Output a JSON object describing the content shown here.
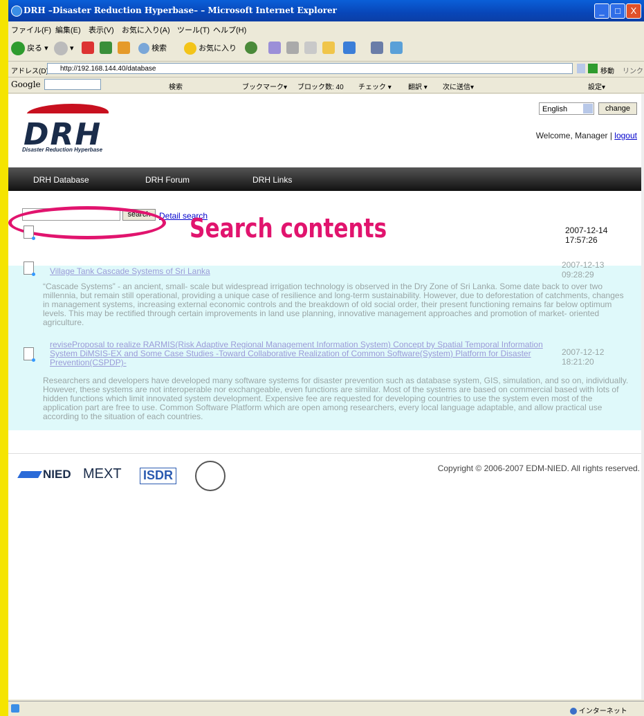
{
  "window": {
    "title": "DRH –Disaster Reduction Hyperbase– – Microsoft Internet Explorer",
    "controls": {
      "minimize": "_",
      "maximize": "□",
      "close": "X"
    }
  },
  "menu": [
    "ファイル(F)",
    "編集(E)",
    "表示(V)",
    "お気に入り(A)",
    "ツール(T)",
    "ヘルプ(H)"
  ],
  "toolbar": {
    "back_label": "戻る",
    "search_label": "検索",
    "favorites_label": "お気に入り"
  },
  "address": {
    "label": "アドレス(D)",
    "url": "http://192.168.144.40/database",
    "go_label": "移動",
    "links_label": "リンク"
  },
  "google_toolbar": {
    "brand": "Google",
    "search_label": "検索",
    "bookmarks_label": "ブックマーク▾",
    "blocked_label": "ブロック数: 40",
    "check_label": "チェック ▾",
    "translate_label": "翻訳 ▾",
    "send_label": "次に送信▾",
    "settings_label": "設定▾"
  },
  "site": {
    "logo_text": "DRH",
    "logo_subtitle": "Disaster Reduction Hyperbase",
    "language": "English",
    "change_label": "change",
    "welcome": "Welcome, Manager | ",
    "logout": "logout",
    "nav": [
      "DRH Database",
      "DRH Forum",
      "DRH Links"
    ]
  },
  "search": {
    "button_label": "search",
    "detail_link": "Detail search",
    "callout": "Search contents"
  },
  "entries": [
    {
      "date": "2007-12-14",
      "time": "17:57:26"
    },
    {
      "title": "Village Tank Cascade Systems of Sri Lanka",
      "date": "2007-12-13",
      "time": "09:28:29",
      "description": "“Cascade Systems” - an ancient, small- scale but widespread irrigation technology is observed in the Dry Zone of Sri Lanka. Some date back to over two millennia, but remain still operational, providing a unique case of resilience and long-term sustainability. However, due to deforestation of catchments, changes in management systems, increasing external economic controls and the breakdown of old social order, their present functioning remains far below optimum levels. This may be rectified through certain improvements in land use planning, innovative management approaches and promotion of market- oriented agriculture."
    },
    {
      "title": "reviseProposal to realize RARMIS(Risk Adaptive Regional Management Information System) Concept by Spatial Temporal Information System DiMSIS-EX and Some Case Studies -Toward Collaborative Realization of Common Software(System) Platform for Disaster Prevention(CSPDP)-",
      "date": "2007-12-12",
      "time": "18:21:20",
      "description": "Researchers and developers have developed many software systems for disaster prevention such as database system, GIS, simulation, and so on, individually. However, these systems are not interoperable nor exchangeable, even functions are similar. Most of the systems are based on commercial based with lots of hidden functions which limit innovated system development. Expensive fee are requested for developing countries to use the system even most of the application part are free to use. Common Software Platform which are open among researchers, every local language adaptable, and allow practical use according to the situation of each countries."
    }
  ],
  "footer": {
    "copyright": "Copyright © 2006-2007 EDM-NIED. All rights reserved.",
    "logos": [
      "NIED",
      "MEXT",
      "ISDR"
    ]
  },
  "statusbar": {
    "zone": "インターネット"
  },
  "colors": {
    "callout": "#e1146e",
    "nav_bg": "#222222",
    "highlight": "#dcf8fa"
  }
}
